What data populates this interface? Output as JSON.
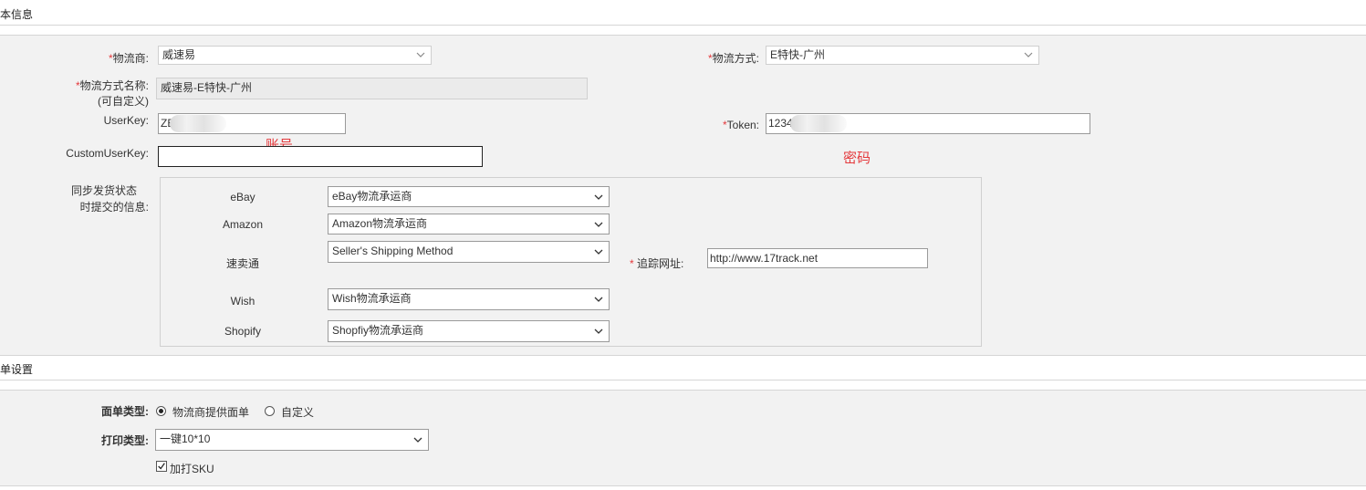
{
  "sections": {
    "basic_info": "本信息",
    "order_settings": "单设置"
  },
  "logistics": {
    "provider_label": "物流商:",
    "provider_value": "威速易",
    "method_label": "物流方式:",
    "method_value": "E特快-广州",
    "method_name_label": "物流方式名称:",
    "method_name_sub": "(可自定义)",
    "method_name_value": "威速易-E特快-广州",
    "userkey_label": "UserKey:",
    "userkey_value": "ZE",
    "token_label": "Token:",
    "token_value": "1234",
    "customuserkey_label": "CustomUserKey:",
    "customuserkey_value": "",
    "required_mark": "*",
    "annotation_account": "账号",
    "annotation_password": "密码"
  },
  "sync": {
    "label_line1": "同步发货状态",
    "label_line2": "时提交的信息:",
    "platforms": [
      {
        "name": "eBay",
        "value": "eBay物流承运商"
      },
      {
        "name": "Amazon",
        "value": "Amazon物流承运商"
      },
      {
        "name": "速卖通",
        "value": "Seller's Shipping Method"
      },
      {
        "name": "Wish",
        "value": "Wish物流承运商"
      },
      {
        "name": "Shopify",
        "value": "Shopfiy物流承运商"
      }
    ],
    "tracking_label": "追踪网址:",
    "tracking_value": "http://www.17track.net"
  },
  "order": {
    "type_label": "面单类型:",
    "type_option_provider": "物流商提供面单",
    "type_option_custom": "自定义",
    "type_selected": "物流商提供面单",
    "print_label": "打印类型:",
    "print_value": "一键10*10",
    "sku_label": "加打SKU",
    "sku_checked": true
  },
  "colors": {
    "required": "#e4393c",
    "panel_bg": "#f2f2f2",
    "border": "#d6d6d6"
  }
}
